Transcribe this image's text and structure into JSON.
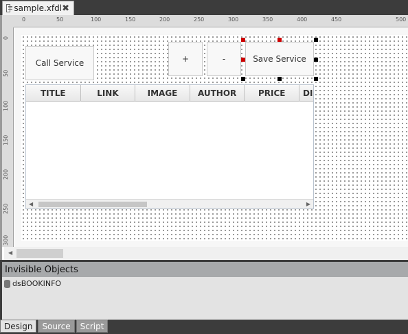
{
  "document_tab": {
    "title": "sample.xfdl",
    "close": "✖"
  },
  "ruler": {
    "x_labels": [
      "0",
      "50",
      "100",
      "150",
      "200",
      "250",
      "300",
      "350",
      "400",
      "450",
      "500"
    ],
    "y_labels": [
      "0",
      "50",
      "100",
      "150",
      "200",
      "250",
      "300"
    ]
  },
  "form": {
    "call_service_button": "Call Service",
    "add_button": "+",
    "remove_button": "-",
    "save_service_button": "Save Service"
  },
  "grid": {
    "columns": [
      "TITLE",
      "LINK",
      "IMAGE",
      "AUTHOR",
      "PRICE",
      "DI"
    ]
  },
  "invisible_objects": {
    "header": "Invisible Objects",
    "items": [
      "dsBOOKINFO"
    ]
  },
  "bottom_tabs": [
    "Design",
    "Source",
    "Script"
  ],
  "selection_colors": {
    "primary": "#cc0000",
    "handle": "#000000"
  }
}
